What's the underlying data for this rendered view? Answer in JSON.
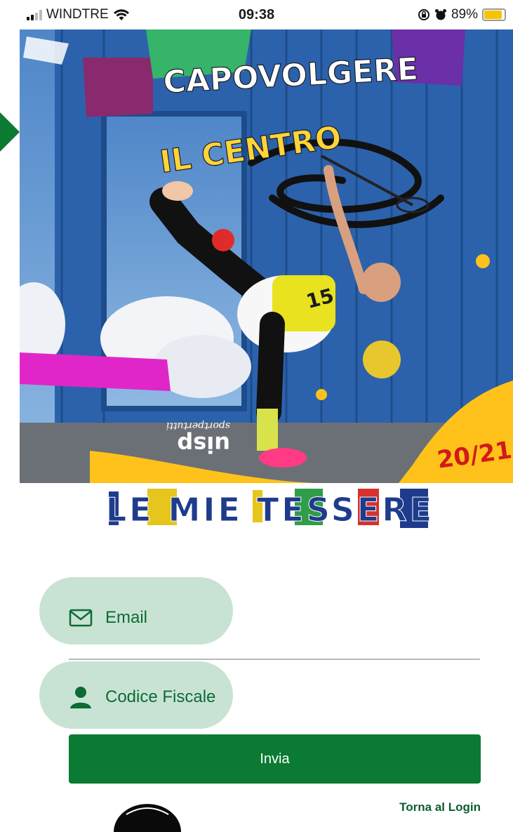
{
  "status_bar": {
    "carrier": "WINDTRE",
    "time": "09:38",
    "battery_percent": "89%",
    "battery_level": 0.89,
    "signal_bars_active": 2,
    "icons": [
      "signal-bars-icon",
      "wifi-icon",
      "rotation-lock-icon",
      "alarm-icon",
      "battery-icon"
    ]
  },
  "poster": {
    "headline_top": "CAPOVOLGERE",
    "headline_bottom": "IL CENTRO",
    "shirt_number": "15",
    "season": "20/21",
    "brand": "uisp",
    "brand_tagline": "sportpertutti"
  },
  "app_title": "LE MIE TESSERE",
  "form": {
    "email_label": "Email",
    "codice_fiscale_label": "Codice Fiscale",
    "submit_label": "Invia"
  },
  "back_to_login": "Torna al Login",
  "colors": {
    "primary_green": "#0b7a33",
    "pill_background": "#c8e3d4",
    "label_green": "#0d6b36",
    "battery_yellow": "#f6c400"
  }
}
